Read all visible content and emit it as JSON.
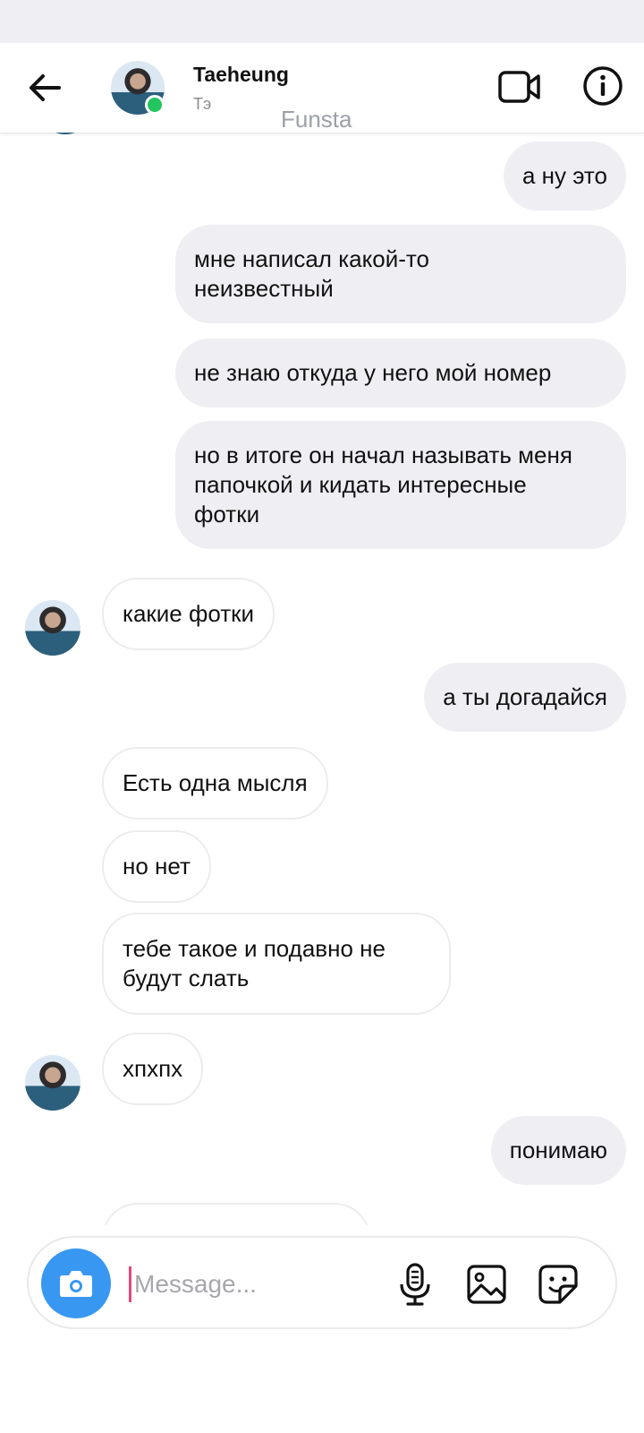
{
  "header": {
    "contact_name": "Taeheung",
    "contact_sub": "Тэ",
    "contact_funsta": "Funsta",
    "icons": {
      "back": "arrow-left-icon",
      "video": "video-camera-icon",
      "info": "info-circle-icon"
    },
    "online_color": "#22c55e"
  },
  "messages": [
    {
      "from": "me",
      "text": "а ну это"
    },
    {
      "from": "me",
      "text": "мне написал какой-то неизвестный"
    },
    {
      "from": "me",
      "text": "не знаю откуда у него мой номер"
    },
    {
      "from": "me",
      "text": "но в итоге он начал называть меня папочкой и кидать интересные фотки"
    },
    {
      "from": "them",
      "text": "какие фотки"
    },
    {
      "from": "me",
      "text": "а ты догадайся"
    },
    {
      "from": "them",
      "text": "Есть одна мысля"
    },
    {
      "from": "them",
      "text": "но нет"
    },
    {
      "from": "them",
      "text": "тебе такое и подавно не будут слать"
    },
    {
      "from": "them",
      "text": "хпхпх"
    },
    {
      "from": "me",
      "text": "понимаю"
    }
  ],
  "composer": {
    "placeholder": "Message...",
    "icons": {
      "camera": "camera-icon",
      "mic": "microphone-icon",
      "gallery": "image-icon",
      "sticker": "sticker-icon"
    }
  },
  "colors": {
    "accent": "#3897f0",
    "my_bubble": "#efeef2",
    "their_bubble_border": "#ececef",
    "cursor": "#e8447a"
  }
}
